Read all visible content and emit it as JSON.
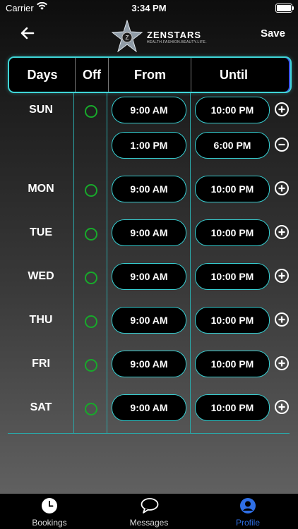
{
  "status_bar": {
    "carrier": "Carrier",
    "time": "3:34 PM"
  },
  "nav": {
    "brand": "ZENSTARS",
    "tagline": "HEALTH.FASHION.BEAUTY.LIFE.",
    "save_label": "Save",
    "logo_letter": "Z"
  },
  "columns": {
    "days": "Days",
    "off": "Off",
    "from": "From",
    "until": "Until"
  },
  "schedule": [
    {
      "day": "SUN",
      "slots": [
        {
          "from": "9:00 AM",
          "until": "10:00 PM",
          "action": "add"
        },
        {
          "from": "1:00 PM",
          "until": "6:00 PM",
          "action": "remove"
        }
      ]
    },
    {
      "day": "MON",
      "slots": [
        {
          "from": "9:00 AM",
          "until": "10:00 PM",
          "action": "add"
        }
      ]
    },
    {
      "day": "TUE",
      "slots": [
        {
          "from": "9:00 AM",
          "until": "10:00 PM",
          "action": "add"
        }
      ]
    },
    {
      "day": "WED",
      "slots": [
        {
          "from": "9:00 AM",
          "until": "10:00 PM",
          "action": "add"
        }
      ]
    },
    {
      "day": "THU",
      "slots": [
        {
          "from": "9:00 AM",
          "until": "10:00 PM",
          "action": "add"
        }
      ]
    },
    {
      "day": "FRI",
      "slots": [
        {
          "from": "9:00 AM",
          "until": "10:00 PM",
          "action": "add"
        }
      ]
    },
    {
      "day": "SAT",
      "slots": [
        {
          "from": "9:00 AM",
          "until": "10:00 PM",
          "action": "add"
        }
      ]
    }
  ],
  "tabs": [
    {
      "label": "Bookings",
      "icon": "clock-icon",
      "active": false
    },
    {
      "label": "Messages",
      "icon": "chat-bubble-icon",
      "active": false
    },
    {
      "label": "Profile",
      "icon": "user-icon",
      "active": true
    }
  ],
  "colors": {
    "accent": "#36cdd0",
    "off_ring": "#18a92b",
    "active_tab": "#2f6fe6"
  }
}
